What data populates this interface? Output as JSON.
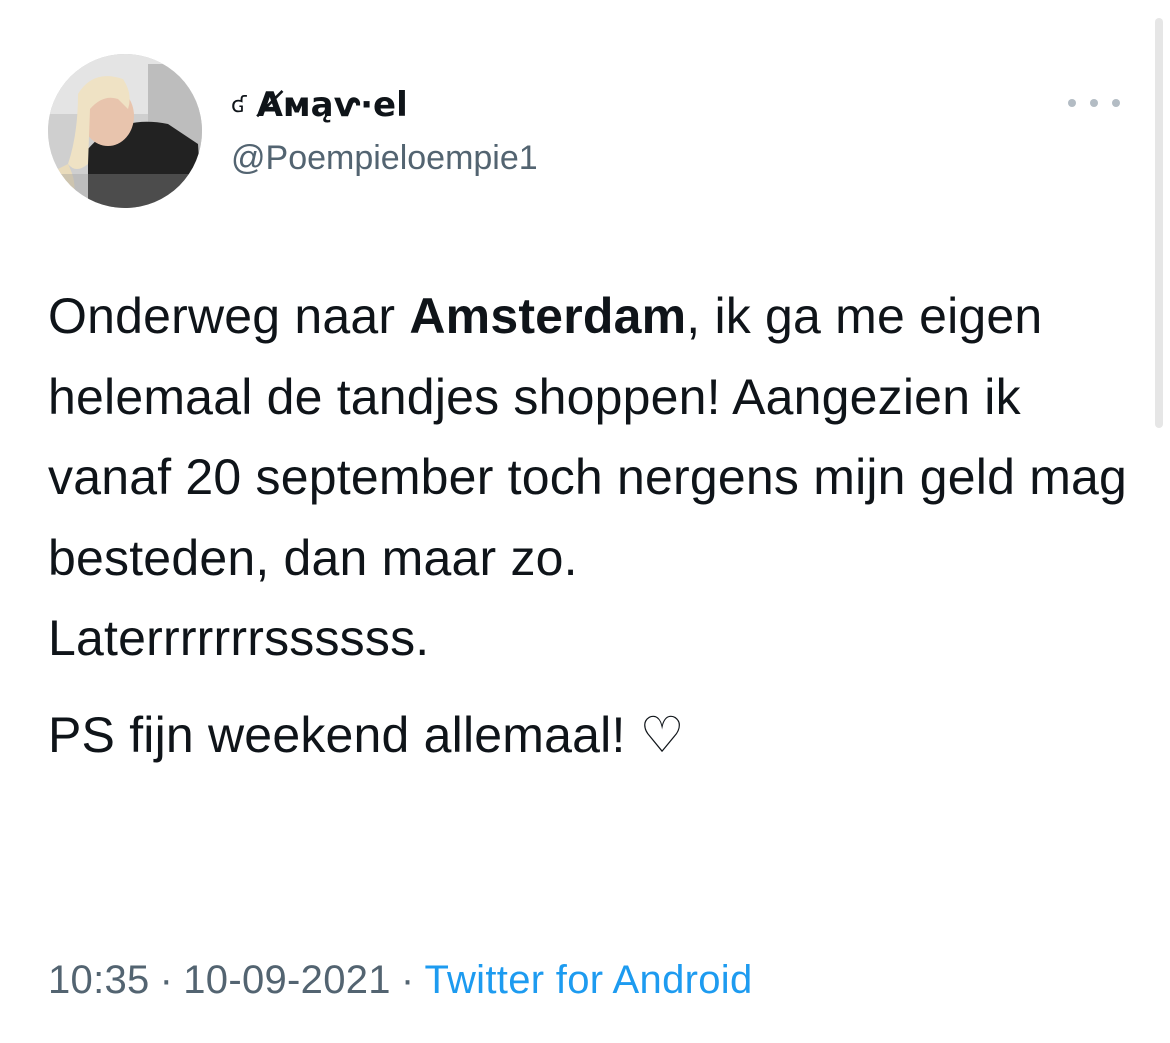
{
  "author": {
    "name_prefix": "ʛ",
    "display_name": "Ⱥмąⱱ·el",
    "handle": "@Poempieloempie1"
  },
  "tweet": {
    "line1_before": "Onderweg naar ",
    "line1_bold": "Amsterdam",
    "line1_after": ", ik ga me eigen helemaal de tandjes shoppen! Aangezien ik vanaf 20 september toch nergens mijn geld mag besteden, dan maar zo.",
    "line2": "Laterrrrrrrssssss.",
    "line3": "PS fijn weekend allemaal! ♡"
  },
  "meta": {
    "time": "10:35",
    "separator": "·",
    "date": "10-09-2021",
    "source": "Twitter for Android"
  },
  "icons": {
    "more": "more-dots-icon",
    "heart": "heart-outline-glyph"
  },
  "colors": {
    "text": "#0f1419",
    "secondary": "#536471",
    "link": "#1d9bf0"
  }
}
